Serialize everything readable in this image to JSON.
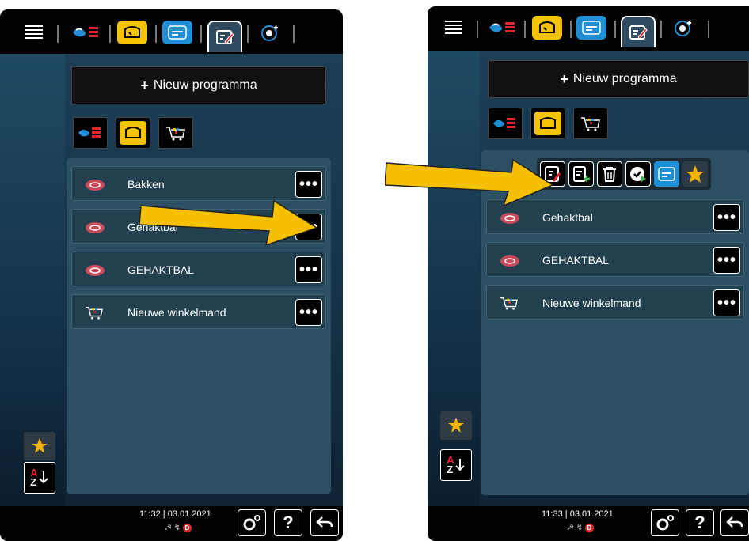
{
  "panel1": {
    "new_program": "Nieuw programma",
    "rows": [
      {
        "label": "Bakken",
        "icon": "steak-icon"
      },
      {
        "label": "Gehaktbal",
        "icon": "steak-icon"
      },
      {
        "label": "GEHAKTBAL",
        "icon": "steak-icon"
      },
      {
        "label": "Nieuwe winkelmand",
        "icon": "basket-icon"
      }
    ],
    "time": "11:32",
    "date": "03.01.2021",
    "more": "•••",
    "help": "?",
    "sort_a": "A",
    "sort_z": "Z"
  },
  "panel2": {
    "new_program": "Nieuw programma",
    "rows": [
      {
        "label": "Gehaktbal",
        "icon": "steak-icon"
      },
      {
        "label": "GEHAKTBAL",
        "icon": "steak-icon"
      },
      {
        "label": "Nieuwe winkelmand",
        "icon": "basket-icon"
      }
    ],
    "time": "11:33",
    "date": "03.01.2021",
    "more": "•••",
    "help": "?",
    "sort_a": "A",
    "sort_z": "Z"
  },
  "colors": {
    "accent_yellow": "#f5c400",
    "accent_blue": "#1e8fd6",
    "arrow": "#f5c000",
    "panel": "#2c4f63"
  }
}
